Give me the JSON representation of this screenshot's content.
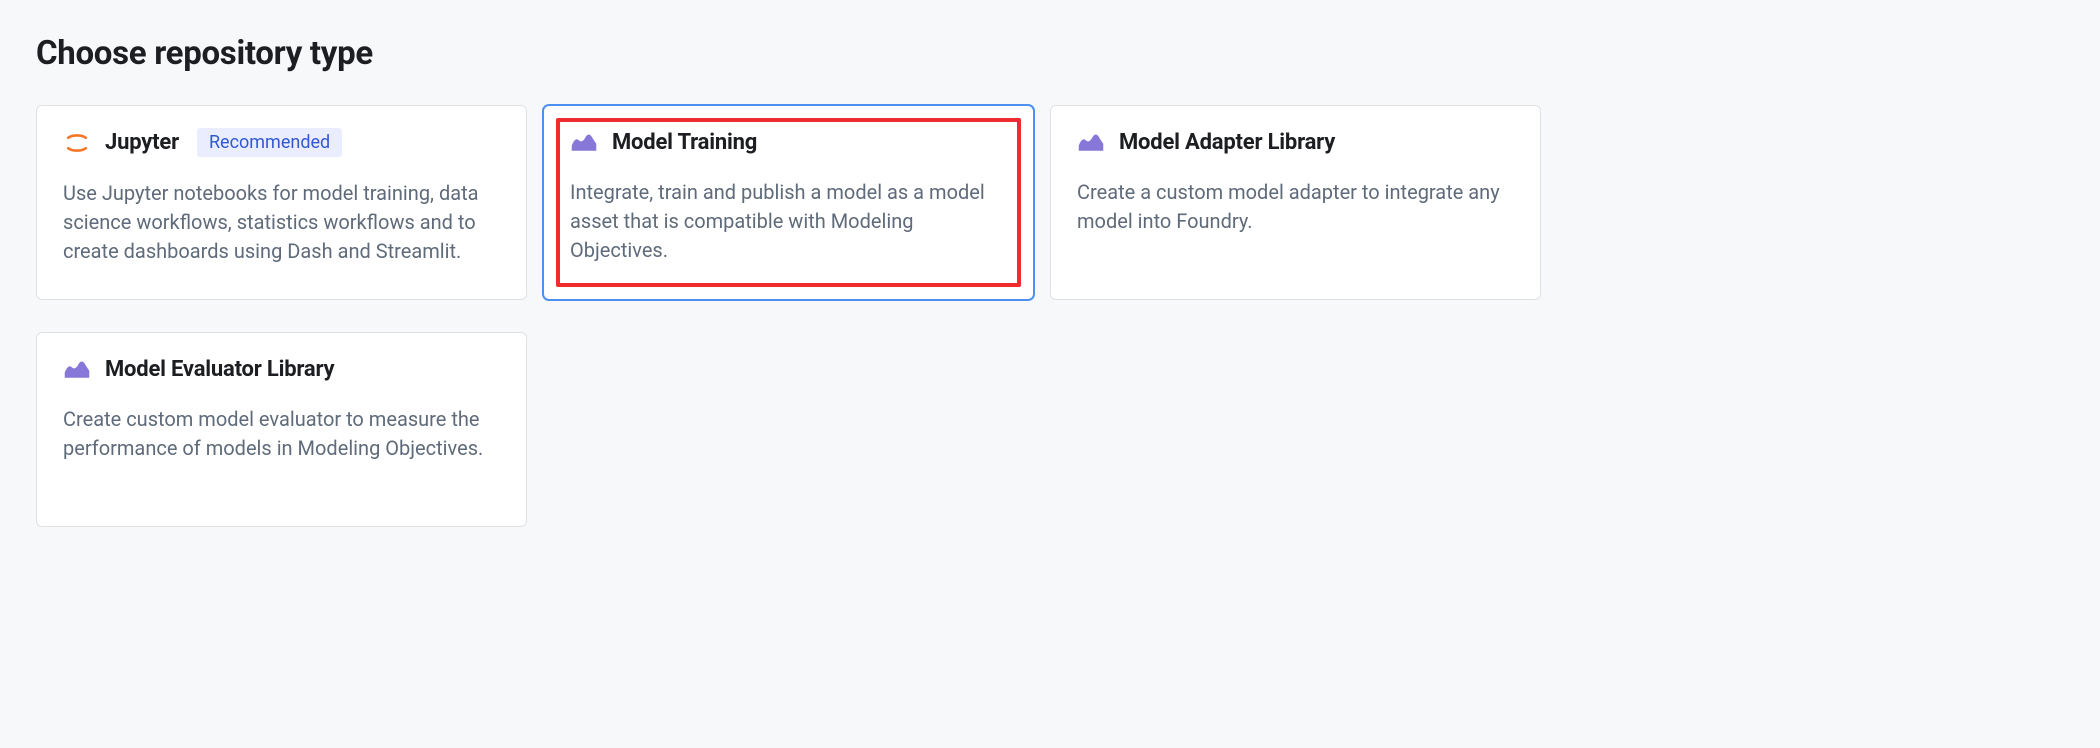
{
  "page_title": "Choose repository type",
  "badge_recommended": "Recommended",
  "cards": {
    "jupyter": {
      "title": "Jupyter",
      "desc": "Use Jupyter notebooks for model training, data science workflows, statistics workflows and to create dashboards using Dash and Streamlit."
    },
    "model_training": {
      "title": "Model Training",
      "desc": "Integrate, train and publish a model as a model asset that is compatible with Modeling Objectives."
    },
    "model_adapter": {
      "title": "Model Adapter Library",
      "desc": "Create a custom model adapter to integrate any model into Foundry."
    },
    "model_evaluator": {
      "title": "Model Evaluator Library",
      "desc": "Create custom model evaluator to measure the performance of models in Modeling Objectives."
    }
  }
}
